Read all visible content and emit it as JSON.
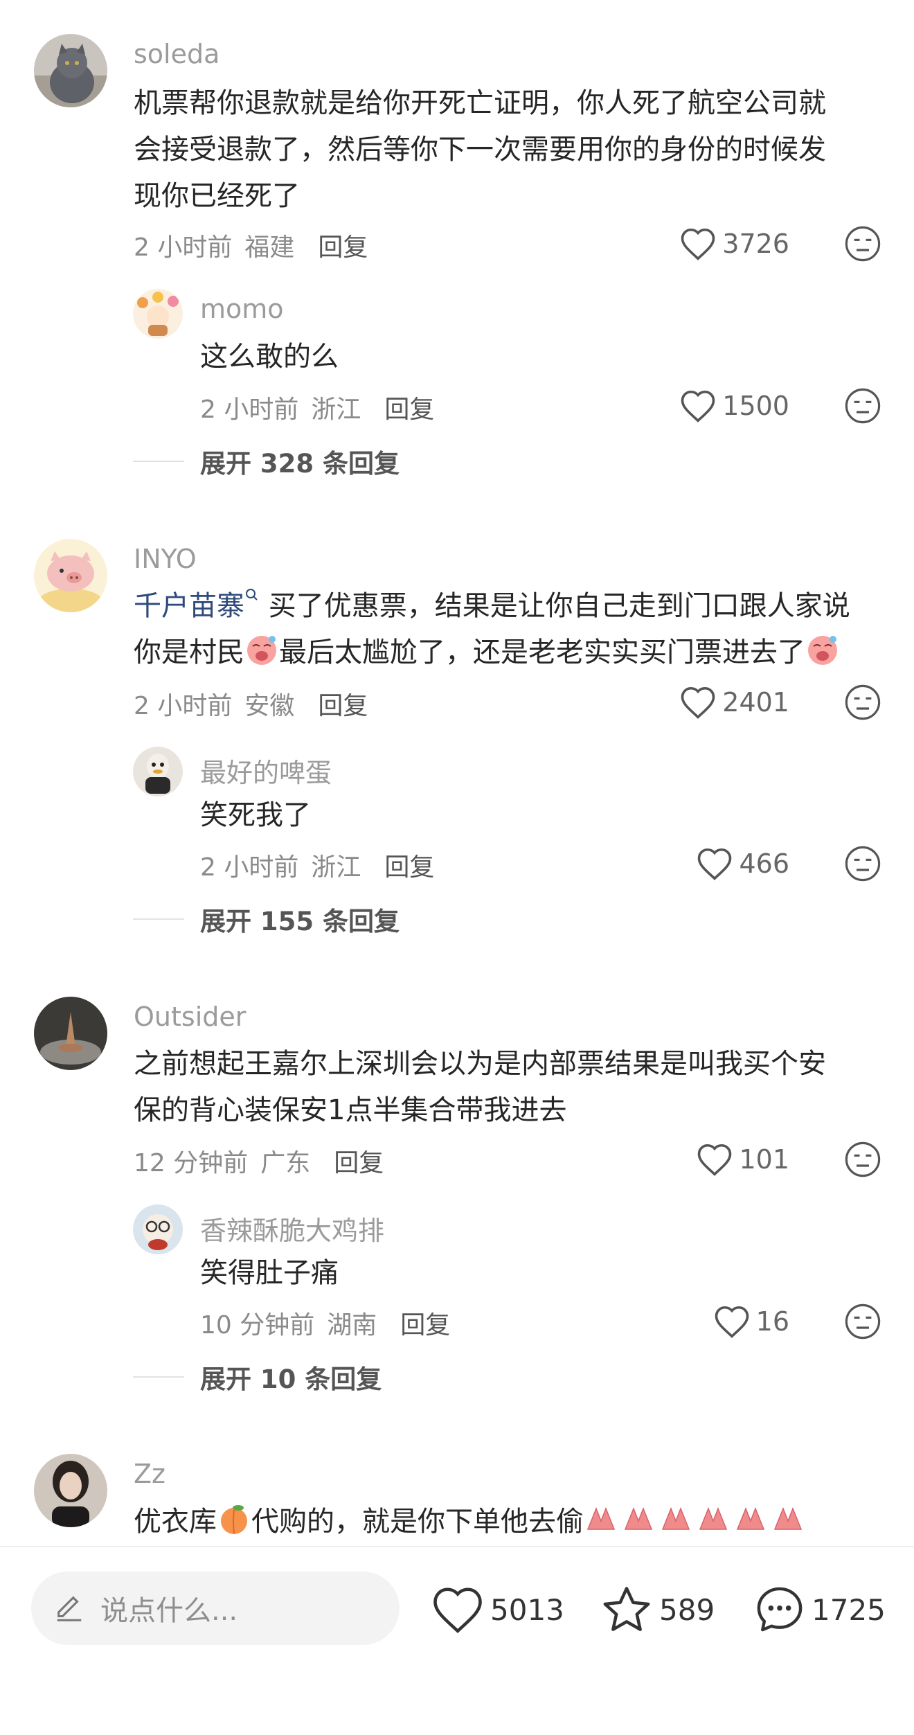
{
  "comments": [
    {
      "username": "soleda",
      "text_lines": [
        "机票帮你退款就是给你开死亡证明，你人死了航空公司就",
        "会接受退款了，然后等你下一次需要用你的身份的时候发",
        "现你已经死了"
      ],
      "time": "2 小时前",
      "location": "福建",
      "reply_label": "回复",
      "likes": "3726",
      "avatar_icon": "cat-avatar",
      "reply": {
        "username": "momo",
        "text": "这么敢的么",
        "time": "2 小时前",
        "location": "浙江",
        "reply_label": "回复",
        "likes": "1500",
        "avatar_icon": "flower-girl-avatar"
      },
      "expand_label": "展开 328 条回复"
    },
    {
      "username": "INYO",
      "mention": "千户苗寨",
      "text_line1_rest": " 买了优惠票，结果是让你自己走到门口跟人家说",
      "text_line2_a": "你是村民",
      "text_line2_b": "最后太尴尬了，还是老老实实买门票进去了",
      "time": "2 小时前",
      "location": "安徽",
      "reply_label": "回复",
      "likes": "2401",
      "avatar_icon": "pig-avatar",
      "reply": {
        "username": "最好的啤蛋",
        "text": "笑死我了",
        "time": "2 小时前",
        "location": "浙江",
        "reply_label": "回复",
        "likes": "466",
        "avatar_icon": "duck-avatar"
      },
      "expand_label": "展开 155 条回复"
    },
    {
      "username": "Outsider",
      "text_lines": [
        "之前想起王嘉尔上深圳会以为是内部票结果是叫我买个安",
        "保的背心装保安1点半集合带我进去"
      ],
      "time": "12 分钟前",
      "location": "广东",
      "reply_label": "回复",
      "likes": "101",
      "avatar_icon": "sculpture-avatar",
      "reply": {
        "username": "香辣酥脆大鸡排",
        "text": "笑得肚子痛",
        "time": "10 分钟前",
        "location": "湖南",
        "reply_label": "回复",
        "likes": "16",
        "avatar_icon": "glasses-avatar"
      },
      "expand_label": "展开 10 条回复"
    },
    {
      "username": "Zz",
      "text_a": "优衣库",
      "text_b": "代购的，就是你下单他去偷",
      "avatar_icon": "woman-avatar"
    }
  ],
  "bottom_bar": {
    "input_placeholder": "说点什么...",
    "likes": "5013",
    "favorites": "589",
    "comments": "1725"
  },
  "colors": {
    "text": "#262626",
    "meta": "#8a8a8a",
    "username": "#9b9b9b",
    "mention": "#2e4a7a"
  }
}
